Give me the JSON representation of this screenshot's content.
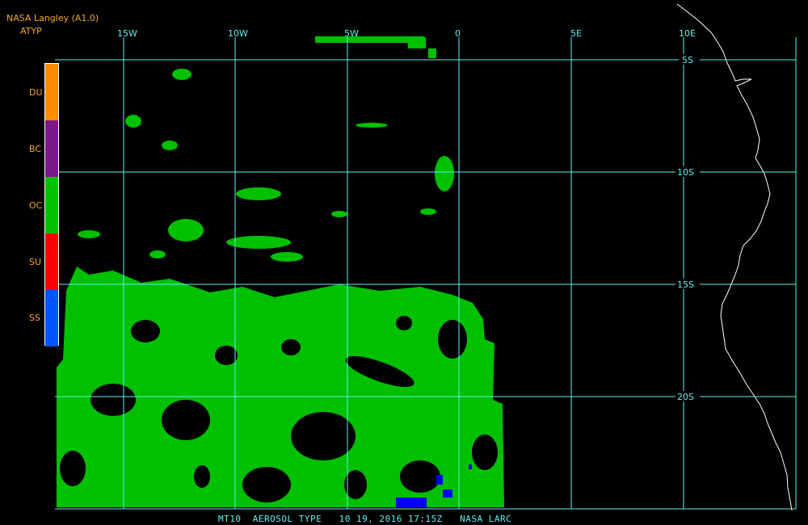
{
  "header": {
    "title": "NASA Langley (A1.0)",
    "product": "ATYP"
  },
  "footer": {
    "text": "MT10  AEROSOL TYPE   10 19, 2016 17:15Z   NASA LARC"
  },
  "legend": [
    {
      "code": "DU",
      "color": "#ff8c00"
    },
    {
      "code": "BC",
      "color": "#7a1a8a"
    },
    {
      "code": "OC",
      "color": "#00c000"
    },
    {
      "code": "SU",
      "color": "#ff0000"
    },
    {
      "code": "SS",
      "color": "#0055ff"
    }
  ],
  "axes": {
    "longitude_labels": [
      "15W",
      "10W",
      "5W",
      "0",
      "5E",
      "10E"
    ],
    "latitude_labels": [
      "5S",
      "10S",
      "15S",
      "20S"
    ]
  },
  "colors": {
    "grid": "#5ff0f0",
    "coast": "#ffffff",
    "aerosol": "#00c000",
    "sea_salt": "#0000ff"
  }
}
